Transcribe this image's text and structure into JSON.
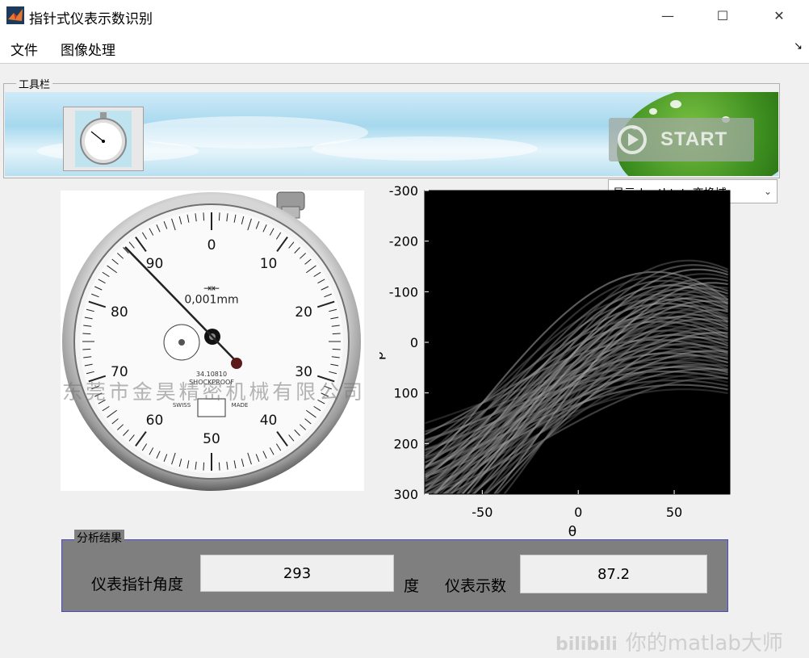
{
  "window": {
    "title": "指针式仪表示数识别",
    "minimize": "—",
    "maximize": "☐",
    "close": "✕"
  },
  "menu": {
    "items": [
      "文件",
      "图像处理"
    ],
    "dock_arrow": "↘"
  },
  "toolbar": {
    "label": "工具栏",
    "start_label": "START"
  },
  "dropdown": {
    "selected": "显示rho-thteta变换域"
  },
  "gauge": {
    "numbers": [
      "0",
      "10",
      "20",
      "30",
      "40",
      "50",
      "60",
      "70",
      "80",
      "90"
    ],
    "unit": "0,001mm",
    "watermark": "东莞市金昊精密机械有限公司"
  },
  "chart_data": {
    "type": "heatmap",
    "title": "",
    "xlabel": "θ",
    "ylabel": "ρ",
    "xlim": [
      -80,
      79
    ],
    "ylim": [
      -300,
      300
    ],
    "x_ticks": [
      "-50",
      "0",
      "50"
    ],
    "y_ticks": [
      "-300",
      "-200",
      "-100",
      "0",
      "100",
      "200",
      "300"
    ]
  },
  "results": {
    "label": "分析结果",
    "angle_label": "仪表指针角度",
    "angle_value": "293",
    "angle_unit": "度",
    "reading_label": "仪表示数",
    "reading_value": "87.2"
  },
  "watermark": "你的matlab大师",
  "colors": {
    "accent": "#f1a94d",
    "panel_bg": "#7f7f7f",
    "window_bg": "#f0f0f0"
  }
}
